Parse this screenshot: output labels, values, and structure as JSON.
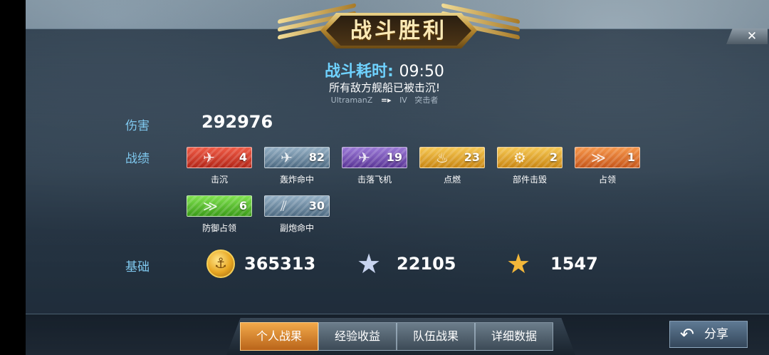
{
  "header": {
    "title": "战斗胜利",
    "close_icon": "close-icon"
  },
  "battle": {
    "duration_label": "战斗耗时:",
    "duration_value": "09:50",
    "status": "所有敌方舰船已被击沉!",
    "player_name": "UltramanZ",
    "ship_tier": "IV",
    "ship_class": "突击者"
  },
  "damage": {
    "label": "伤害",
    "value": "292976"
  },
  "achievements": {
    "label": "战绩",
    "items": [
      {
        "name": "击沉",
        "count": "4",
        "icon": "ship-sink-icon",
        "color": "#d83a2a"
      },
      {
        "name": "轰炸命中",
        "count": "82",
        "icon": "bomber-icon",
        "color": "#6f8fa8"
      },
      {
        "name": "击落飞机",
        "count": "19",
        "icon": "plane-down-icon",
        "color": "#7b55b8"
      },
      {
        "name": "点燃",
        "count": "23",
        "icon": "fire-icon",
        "color": "#e6a51f"
      },
      {
        "name": "部件击毁",
        "count": "2",
        "icon": "gear-icon",
        "color": "#e6a51f"
      },
      {
        "name": "占领",
        "count": "1",
        "icon": "chevron-icon",
        "color": "#e8782a"
      },
      {
        "name": "防御占领",
        "count": "6",
        "icon": "chevron-icon",
        "color": "#4fbf2a"
      },
      {
        "name": "副炮命中",
        "count": "30",
        "icon": "secondary-gun-icon",
        "color": "#6f8fa8"
      }
    ]
  },
  "base": {
    "label": "基础",
    "credits": "365313",
    "exp": "22105",
    "captain_exp": "1547"
  },
  "tabs": [
    "个人战果",
    "经验收益",
    "队伍战果",
    "详细数据"
  ],
  "share": {
    "label": "分享"
  }
}
